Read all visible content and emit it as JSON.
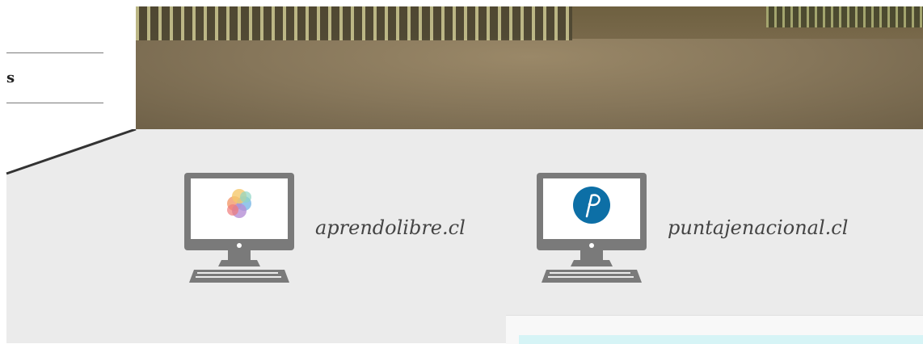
{
  "menu": {
    "item_label": "s"
  },
  "sites": [
    {
      "label": "aprendolibre.cl"
    },
    {
      "label": "puntajenacional.cl"
    }
  ],
  "colors": {
    "gray_bg": "#ebebeb",
    "monitor": "#7a7a7a",
    "logo_blue": "#0d6fa6",
    "label_text": "#444444",
    "panel_accent": "#d6f4f6"
  },
  "icons": [
    "computer-icon",
    "aprendolibre-logo",
    "puntajenacional-logo"
  ]
}
